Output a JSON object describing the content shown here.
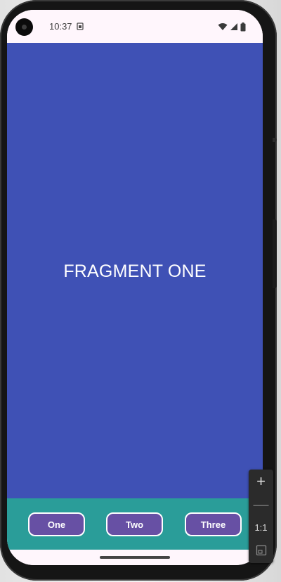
{
  "status_bar": {
    "time": "10:37",
    "icons": [
      "sim-card-icon",
      "wifi-icon",
      "signal-icon",
      "battery-icon"
    ]
  },
  "fragment": {
    "title": "FRAGMENT ONE",
    "background_color": "#3f51b5"
  },
  "button_bar": {
    "background_color": "#2a9d99",
    "buttons": [
      {
        "label": "One"
      },
      {
        "label": "Two"
      },
      {
        "label": "Three"
      }
    ],
    "button_color": "#6750a4"
  },
  "zoom_toolbar": {
    "zoom_in": "+",
    "zoom_out": "—",
    "actual_size": "1:1",
    "fit_icon": "fit-screen-icon"
  }
}
